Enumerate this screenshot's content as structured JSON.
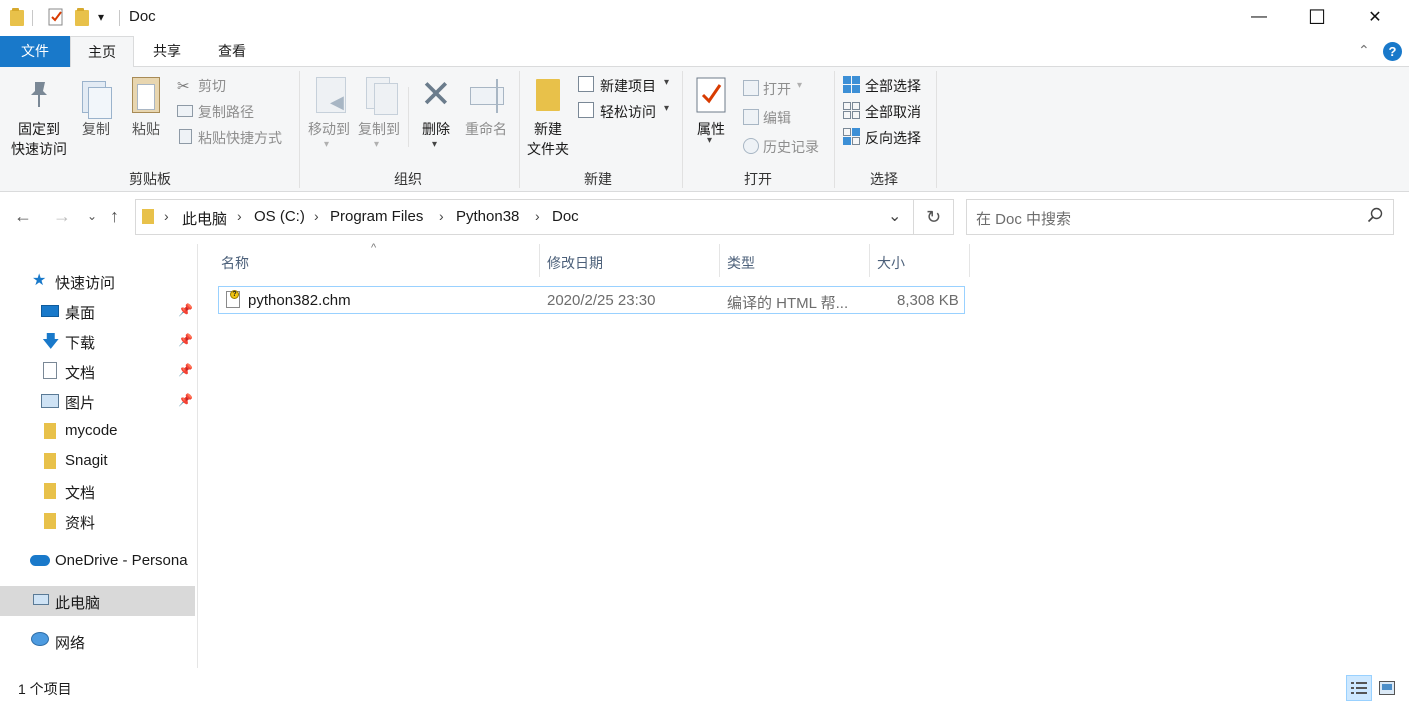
{
  "window": {
    "title": "Doc",
    "quick_access_dropdown": "▾",
    "minimize": "—",
    "maximize": "☐",
    "close": "✕"
  },
  "tabs": [
    "文件",
    "主页",
    "共享",
    "查看"
  ],
  "ribbon": {
    "clipboard": {
      "pin_line1": "固定到",
      "pin_line2": "快速访问",
      "copy": "复制",
      "paste": "粘贴",
      "cut": "剪切",
      "copy_path": "复制路径",
      "paste_shortcut": "粘贴快捷方式",
      "group": "剪贴板"
    },
    "organize": {
      "move_to": "移动到",
      "copy_to": "复制到",
      "delete": "删除",
      "rename": "重命名",
      "group": "组织"
    },
    "new": {
      "new_item": "新建项目",
      "easy_access": "轻松访问",
      "new_folder_line1": "新建",
      "new_folder_line2": "文件夹",
      "group": "新建"
    },
    "open": {
      "properties": "属性",
      "open": "打开",
      "edit": "编辑",
      "history": "历史记录",
      "group": "打开"
    },
    "select": {
      "select_all": "全部选择",
      "select_none": "全部取消",
      "invert": "反向选择",
      "group": "选择"
    }
  },
  "address": {
    "crumbs": [
      "此电脑",
      "OS (C:)",
      "Program Files",
      "Python38",
      "Doc"
    ],
    "search_placeholder": "在 Doc 中搜索"
  },
  "nav": {
    "quick_access": "快速访问",
    "items": [
      {
        "label": "桌面",
        "pinned": true
      },
      {
        "label": "下载",
        "pinned": true
      },
      {
        "label": "文档",
        "pinned": true
      },
      {
        "label": "图片",
        "pinned": true
      },
      {
        "label": "mycode",
        "pinned": false
      },
      {
        "label": "Snagit",
        "pinned": false
      },
      {
        "label": "文档",
        "pinned": false
      },
      {
        "label": "资料",
        "pinned": false
      }
    ],
    "onedrive": "OneDrive - Persona",
    "this_pc": "此电脑",
    "network": "网络"
  },
  "columns": [
    "名称",
    "修改日期",
    "类型",
    "大小"
  ],
  "files": [
    {
      "name": "python382.chm",
      "modified": "2020/2/25 23:30",
      "type": "编译的 HTML 帮...",
      "size": "8,308 KB"
    }
  ],
  "status": {
    "count": "1 个项目"
  },
  "colors": {
    "accent": "#1979ca",
    "selected_nav": "#d9d9d9",
    "folder": "#e8c14a"
  }
}
